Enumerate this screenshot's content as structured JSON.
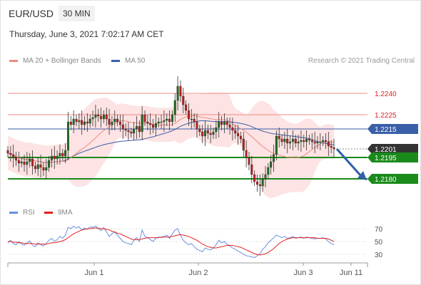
{
  "header": {
    "symbol": "EUR/USD",
    "timeframe": "30 MIN",
    "datetime": "Thursday, June 3, 2021 7:02:17 AM CET"
  },
  "legend": {
    "ma20_label": "MA 20 + Bollinger Bands",
    "ma50_label": "MA 50",
    "rsi_label": "RSI",
    "rsi_ma_label": "9MA",
    "credit": "Research © 2021 Trading Central"
  },
  "colors": {
    "ma20": "#f08a84",
    "band_fill": "#fde0e0",
    "ma50": "#3a5fa8",
    "support": "#1a8a1a",
    "current": "#333333",
    "arrow": "#2f5fa5",
    "rsi": "#6a8fe0",
    "rsi_ma": "#e02020",
    "candle_up": "#1f6b1f",
    "candle_down": "#b52020"
  },
  "chart_data": {
    "type": "candlestick",
    "x_ticks": [
      "Jun 1",
      "Jun 2",
      "Jun 3",
      "Jun 11"
    ],
    "ylim": [
      1.2163,
      1.2258
    ],
    "levels": [
      {
        "label": "1.2240",
        "value": 1.224,
        "kind": "resistance"
      },
      {
        "label": "1.2225",
        "value": 1.2225,
        "kind": "resistance"
      },
      {
        "label": "1.2215",
        "value": 1.2215,
        "kind": "ma50"
      },
      {
        "label": "1.2201",
        "value": 1.2201,
        "kind": "current"
      },
      {
        "label": "1.2195",
        "value": 1.2195,
        "kind": "support"
      },
      {
        "label": "1.2180",
        "value": 1.218,
        "kind": "support"
      }
    ],
    "forecast_arrow": {
      "from": 1.2201,
      "to": 1.218
    },
    "close_series": [
      1.2198,
      1.2197,
      1.2195,
      1.2193,
      1.2191,
      1.2192,
      1.219,
      1.2192,
      1.2194,
      1.2189,
      1.2187,
      1.219,
      1.2188,
      1.2186,
      1.2188,
      1.2193,
      1.2196,
      1.2194,
      1.2196,
      1.2198,
      1.2196,
      1.22,
      1.222,
      1.2218,
      1.2222,
      1.222,
      1.2221,
      1.2218,
      1.222,
      1.2219,
      1.2222,
      1.2223,
      1.2225,
      1.2224,
      1.2222,
      1.2225,
      1.2222,
      1.2218,
      1.222,
      1.2222,
      1.222,
      1.2218,
      1.2215,
      1.2214,
      1.2213,
      1.2212,
      1.2215,
      1.2217,
      1.2213,
      1.2225,
      1.222,
      1.2219,
      1.2218,
      1.2216,
      1.2219,
      1.222,
      1.222,
      1.2221,
      1.2222,
      1.222,
      1.2225,
      1.2235,
      1.2245,
      1.2238,
      1.2232,
      1.2228,
      1.2222,
      1.2222,
      1.222,
      1.2215,
      1.2213,
      1.221,
      1.2214,
      1.2212,
      1.2211,
      1.2213,
      1.2216,
      1.222,
      1.2218,
      1.222,
      1.2218,
      1.2216,
      1.2214,
      1.2212,
      1.221,
      1.2208,
      1.22,
      1.2195,
      1.219,
      1.2183,
      1.2178,
      1.2176,
      1.2175,
      1.218,
      1.2183,
      1.2188,
      1.2192,
      1.2197,
      1.221,
      1.2208,
      1.2206,
      1.2208,
      1.2205,
      1.2206,
      1.2208,
      1.2205,
      1.2206,
      1.2207,
      1.2206,
      1.2208,
      1.2207,
      1.2206,
      1.2205,
      1.2206,
      1.2206,
      1.2207,
      1.2206,
      1.2203,
      1.2202,
      1.2201
    ],
    "rsi": {
      "ticks": [
        70,
        50,
        30
      ],
      "ylim": [
        20,
        80
      ],
      "rsi_values": [
        48,
        52,
        47,
        45,
        50,
        46,
        44,
        48,
        51,
        44,
        42,
        48,
        45,
        43,
        47,
        52,
        55,
        50,
        53,
        58,
        55,
        60,
        72,
        70,
        74,
        71,
        73,
        68,
        71,
        69,
        73,
        72,
        74,
        70,
        67,
        72,
        65,
        58,
        62,
        65,
        60,
        55,
        50,
        48,
        47,
        45,
        52,
        56,
        50,
        68,
        58,
        56,
        53,
        50,
        55,
        57,
        56,
        58,
        60,
        55,
        62,
        68,
        70,
        60,
        52,
        48,
        45,
        47,
        42,
        38,
        36,
        34,
        40,
        38,
        37,
        40,
        45,
        52,
        48,
        50,
        46,
        43,
        40,
        38,
        35,
        33,
        30,
        28,
        27,
        26,
        25,
        28,
        31,
        38,
        42,
        48,
        52,
        56,
        60,
        58,
        56,
        58,
        55,
        56,
        58,
        55,
        56,
        57,
        55,
        57,
        56,
        55,
        54,
        55,
        55,
        56,
        54,
        50,
        47,
        45
      ],
      "rsi_ma_values": [
        50,
        50,
        49,
        49,
        48,
        48,
        47,
        47,
        47,
        47,
        46,
        46,
        46,
        46,
        46,
        47,
        48,
        48,
        49,
        50,
        51,
        53,
        56,
        59,
        62,
        64,
        66,
        68,
        69,
        70,
        70,
        71,
        71,
        71,
        70,
        70,
        69,
        68,
        66,
        65,
        63,
        62,
        60,
        58,
        56,
        54,
        53,
        53,
        53,
        54,
        55,
        56,
        56,
        56,
        56,
        56,
        57,
        57,
        57,
        57,
        58,
        59,
        60,
        61,
        60,
        59,
        58,
        56,
        54,
        52,
        49,
        46,
        44,
        42,
        41,
        40,
        40,
        41,
        42,
        43,
        44,
        44,
        44,
        43,
        42,
        41,
        39,
        37,
        35,
        33,
        31,
        30,
        29,
        30,
        31,
        33,
        36,
        39,
        43,
        47,
        50,
        52,
        54,
        55,
        56,
        56,
        56,
        56,
        56,
        56,
        56,
        56,
        56,
        55,
        55,
        55,
        55,
        54,
        52,
        50
      ]
    }
  }
}
